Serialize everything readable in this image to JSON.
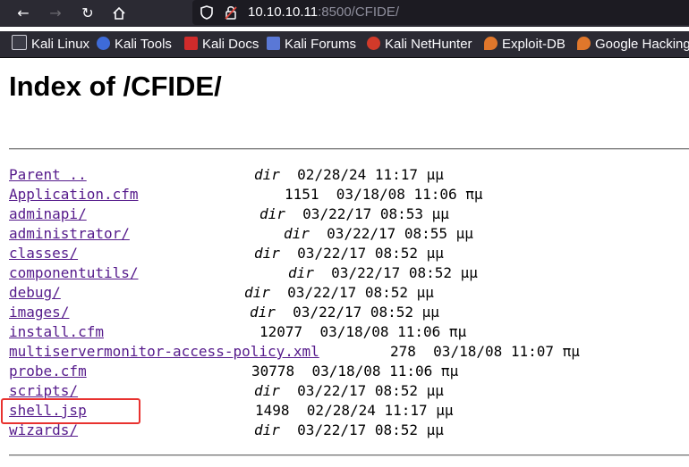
{
  "browser": {
    "url_host": "10.10.10.11",
    "url_rest": ":8500/CFIDE/",
    "bookmarks": [
      {
        "label": "Kali Linux",
        "color": "#ffffff"
      },
      {
        "label": "Kali Tools",
        "color": "#3e6bd8"
      },
      {
        "label": "Kali Docs",
        "color": "#d02b2b"
      },
      {
        "label": "Kali Forums",
        "color": "#5a78d6"
      },
      {
        "label": "Kali NetHunter",
        "color": "#d23a2a"
      },
      {
        "label": "Exploit-DB",
        "color": "#e0772b"
      },
      {
        "label": "Google Hacking",
        "color": "#e0772b"
      }
    ]
  },
  "page": {
    "title": "Index of /CFIDE/",
    "entries": [
      {
        "name": "Parent ..",
        "size": "dir",
        "date": "02/28/24 11:17 μμ"
      },
      {
        "name": "Application.cfm",
        "size": "1151",
        "date": "03/18/08 11:06 πμ"
      },
      {
        "name": "adminapi/",
        "size": "dir",
        "date": "03/22/17 08:53 μμ"
      },
      {
        "name": "administrator/",
        "size": "dir",
        "date": "03/22/17 08:55 μμ"
      },
      {
        "name": "classes/",
        "size": "dir",
        "date": "03/22/17 08:52 μμ"
      },
      {
        "name": "componentutils/",
        "size": "dir",
        "date": "03/22/17 08:52 μμ"
      },
      {
        "name": "debug/",
        "size": "dir",
        "date": "03/22/17 08:52 μμ"
      },
      {
        "name": "images/",
        "size": "dir",
        "date": "03/22/17 08:52 μμ"
      },
      {
        "name": "install.cfm",
        "size": "12077",
        "date": "03/18/08 11:06 πμ"
      },
      {
        "name": "multiservermonitor-access-policy.xml",
        "size": "278",
        "date": "03/18/08 11:07 πμ"
      },
      {
        "name": "probe.cfm",
        "size": "30778",
        "date": "03/18/08 11:06 πμ"
      },
      {
        "name": "scripts/",
        "size": "dir",
        "date": "03/22/17 08:52 μμ"
      },
      {
        "name": "shell.jsp",
        "size": "1498",
        "date": "02/28/24 11:17 μμ"
      },
      {
        "name": "wizards/",
        "size": "dir",
        "date": "03/22/17 08:52 μμ"
      }
    ]
  }
}
